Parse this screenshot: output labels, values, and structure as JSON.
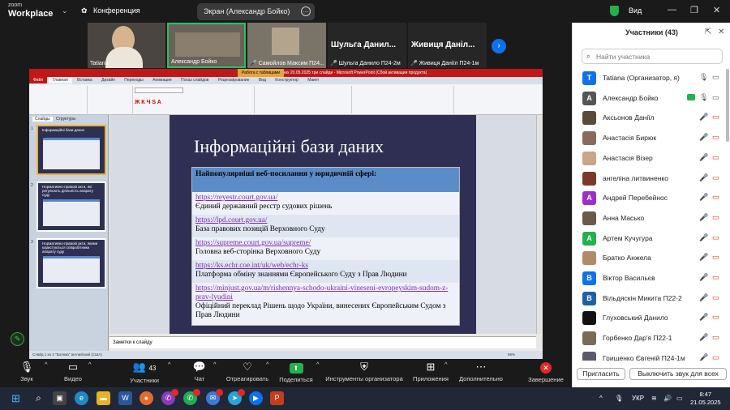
{
  "app": {
    "logo_zoom": "zoom",
    "logo_workplace": "Workplace",
    "meeting_title": "Конференция",
    "screen_share_label": "Экран (Александр Бойко)",
    "view_label": "Вид"
  },
  "video": {
    "tile1": "Tatiana",
    "tile2": "Александр Бойко",
    "tile3_name": "Самойлов Максим П24...",
    "tile4_big": "Шульга Данил...",
    "tile4_name": "Шульга Данило П24-2м",
    "tile5_big": "Живиця Даніл...",
    "tile5_name": "Живиця Даніїл П24-1м"
  },
  "ppt": {
    "window_title": "Інформаційні бази даних 20.05.2025 три слайди - Microsoft PowerPoint (Сбой активации продукта)",
    "context_tab": "Работа с таблицами",
    "tabs": [
      "Файл",
      "Главная",
      "Вставка",
      "Дизайн",
      "Переходы",
      "Анимация",
      "Показ слайдов",
      "Рецензирование",
      "Вид",
      "Конструктор",
      "Макет"
    ],
    "pane_tabs": [
      "Слайды",
      "Структура"
    ],
    "thumbs": [
      {
        "num": "1",
        "title": "Інформаційні бази даних"
      },
      {
        "num": "2",
        "title": "Нормативно-правові акти, які регулюють діяльність апарату суду"
      },
      {
        "num": "3",
        "title": "Нормативно-правові акти, якими користуються співробітники апарату суду"
      }
    ],
    "notes_placeholder": "Заметки к слайду",
    "status": "Слайд 1 из 3   \"Богема\"   английский (США)",
    "zoom": "66%"
  },
  "slide": {
    "title": "Інформаційні бази даних",
    "table_header": "Найпопулярніші веб-посилання у юридичній сфері:",
    "rows": [
      {
        "link": "https://reyestr.court.gov.ua/",
        "desc": "Єдиний державний реєстр судових рішень"
      },
      {
        "link": "https://lpd.court.gov.ua/",
        "desc": "База правових позицій Верховного Суду"
      },
      {
        "link": "https://supreme.court.gov.ua/supreme/",
        "desc": "Головна веб-сторінка Верховного Суду"
      },
      {
        "link": "https://ks.echr.coe.int/uk/web/echr-ks",
        "desc": "Платформа обміну знаннями Європейського Суду з Прав Людини"
      },
      {
        "link": "https://minjust.gov.ua/m/rishennya-schodo-ukraini-vineseni-evropeyskim-sudom-z-prav-lyudini",
        "desc": "Офіційний переклад Рішень щодо України, винесених Європейським Судом з Прав Людини"
      }
    ]
  },
  "toolbar": {
    "audio": "Звук",
    "video": "Видео",
    "participants": "Участники",
    "participants_count": "43",
    "chat": "Чат",
    "react": "Отреагировать",
    "share": "Поделиться",
    "host_tools": "Инструменты организатора",
    "apps": "Приложения",
    "more": "Дополнительно",
    "end": "Завершение"
  },
  "panel": {
    "title": "Участники (43)",
    "search_placeholder": "Найти участника",
    "participants": [
      {
        "name": "Tatiana (Организатор, я)",
        "initial": "T",
        "color": "#0e71eb"
      },
      {
        "name": "Александр Бойко",
        "initial": "A",
        "color": "#555555"
      },
      {
        "name": "Аксьонов Даніїл",
        "initial": "",
        "color": "#5a4a3a"
      },
      {
        "name": "Анастасія Бирюк",
        "initial": "",
        "color": "#8a6a5a"
      },
      {
        "name": "Анастасія Візер",
        "initial": "",
        "color": "#c9a58a"
      },
      {
        "name": "ангеліна литвиненко",
        "initial": "",
        "color": "#7a3a2a"
      },
      {
        "name": "Андрей Перебейнос",
        "initial": "A",
        "color": "#9b2fc9"
      },
      {
        "name": "Анна Масько",
        "initial": "",
        "color": "#6a5a4a"
      },
      {
        "name": "Артем Кучугура",
        "initial": "A",
        "color": "#22b14c"
      },
      {
        "name": "Братко Анжела",
        "initial": "",
        "color": "#b08a6a"
      },
      {
        "name": "Віктор Васильєв",
        "initial": "B",
        "color": "#0e71eb"
      },
      {
        "name": "Вільдяскін Микита П22-2",
        "initial": "B",
        "color": "#1f5fa8"
      },
      {
        "name": "Глуховський Данило",
        "initial": "",
        "color": "#111111"
      },
      {
        "name": "Горбенко Дар'я П22-1",
        "initial": "",
        "color": "#7a6a5a"
      },
      {
        "name": "Грищенко Євгеній П24-1м",
        "initial": "",
        "color": "#5a5a6a"
      }
    ],
    "invite_button": "Пригласить",
    "mute_all_button": "Выключить звук для всех"
  },
  "taskbar": {
    "lang": "УКР",
    "time": "8:47",
    "date": "21.05.2025"
  }
}
